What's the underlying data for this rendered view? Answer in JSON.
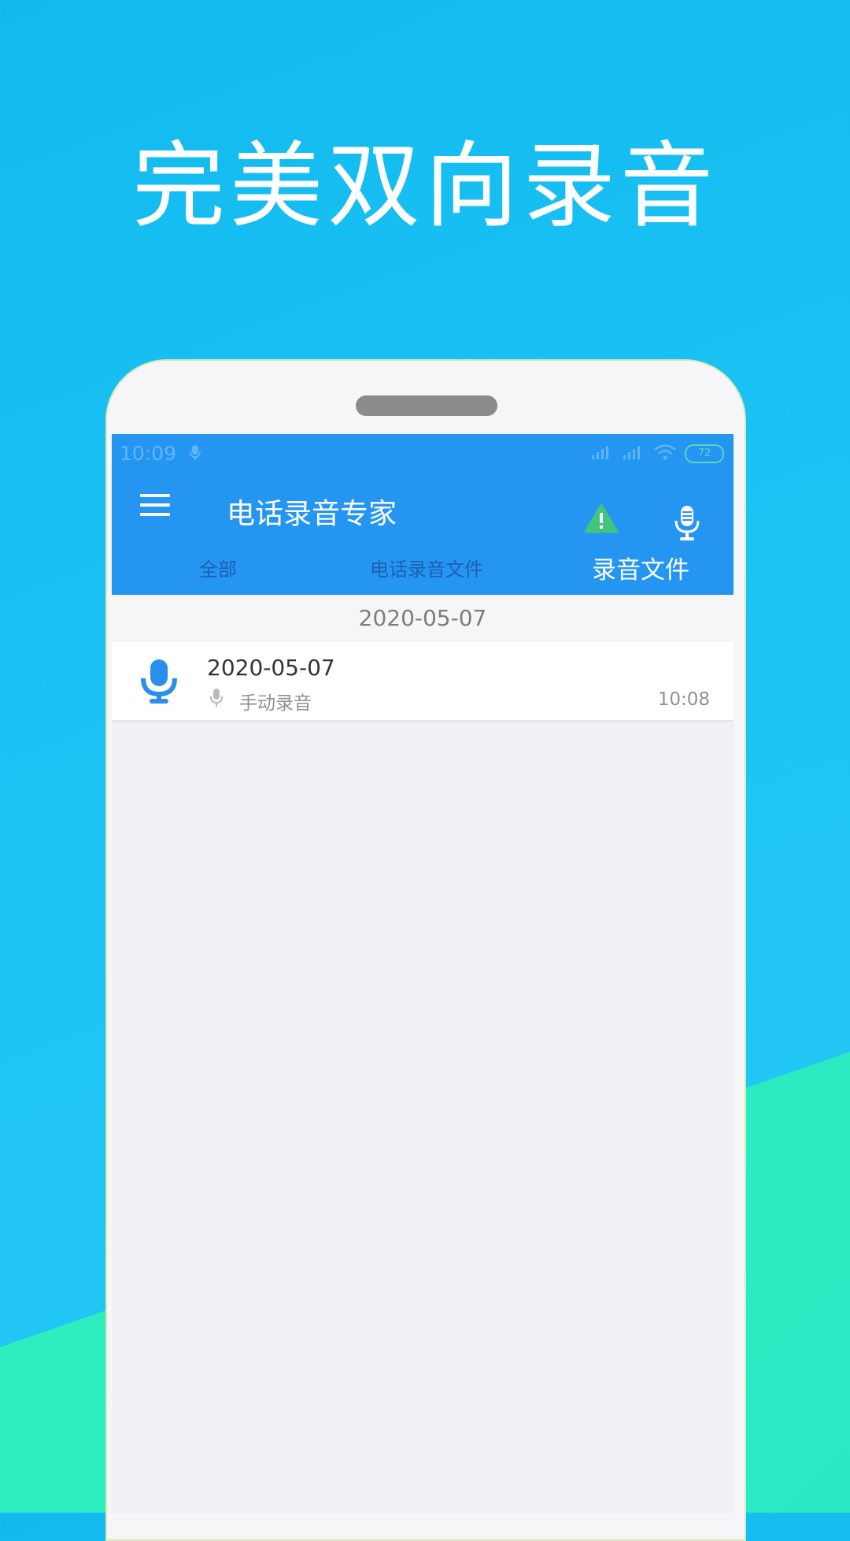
{
  "promo": {
    "headline": "完美双向录音"
  },
  "status_bar": {
    "time": "10:09",
    "battery": "72",
    "icons": [
      "mic-icon",
      "signal-icon",
      "signal-icon",
      "wifi-icon",
      "battery-icon"
    ]
  },
  "app_bar": {
    "title": "电话录音专家",
    "menu_icon": "menu-icon",
    "warning_icon": "warning-icon",
    "record_icon": "microphone-icon"
  },
  "tabs": [
    {
      "label": "全部",
      "selected": false
    },
    {
      "label": "电话录音文件",
      "selected": false
    },
    {
      "label": "录音文件",
      "selected": true
    }
  ],
  "list": {
    "date_header": "2020-05-07",
    "items": [
      {
        "title": "2020-05-07",
        "subtitle": "手动录音",
        "time": "10:08",
        "icon": "microphone-icon"
      }
    ]
  },
  "colors": {
    "app_bar": "#2496f1",
    "warning": "#43c47b",
    "accent_blue": "#2a8fea",
    "background_top": "#12b9ef",
    "background_bottom": "#31f5b6"
  }
}
